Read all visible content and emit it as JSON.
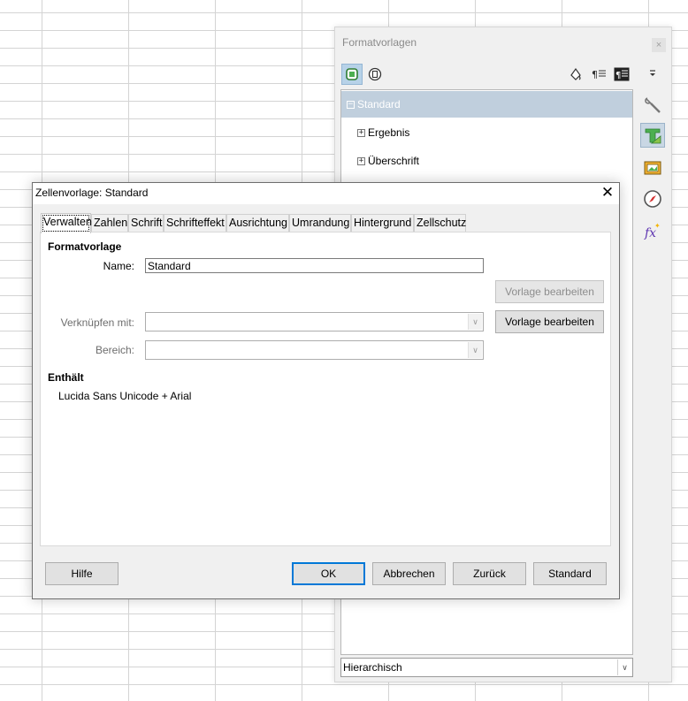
{
  "deck": {
    "title": "Formatvorlagen",
    "close_glyph": "×",
    "toolbar_left": [
      {
        "icon": "cell-styles-icon",
        "active": true
      },
      {
        "icon": "page-styles-icon",
        "active": false
      }
    ],
    "toolbar_right": [
      {
        "icon": "fill-format-mode-icon"
      },
      {
        "icon": "new-style-from-selection-icon"
      },
      {
        "icon": "styles-actions-icon"
      }
    ],
    "tree": {
      "items": [
        {
          "label": "Standard",
          "toggle": "⊟",
          "selected": true
        },
        {
          "label": "Ergebnis",
          "toggle": "⊞",
          "selected": false
        },
        {
          "label": "Überschrift",
          "toggle": "⊞",
          "selected": false
        }
      ]
    },
    "filter": {
      "value": "Hierarchisch",
      "arrow": "∨"
    },
    "sidebar": [
      {
        "icon": "sidebar-menu-icon"
      },
      {
        "icon": "properties-wrench-icon"
      },
      {
        "icon": "styles-icon",
        "active": true
      },
      {
        "icon": "gallery-icon"
      },
      {
        "icon": "navigator-icon"
      },
      {
        "icon": "functions-icon"
      }
    ]
  },
  "dialog": {
    "title": "Zellenvorlage: Standard",
    "close_glyph": "✕",
    "tabs": [
      {
        "label": "Verwalten",
        "active": true
      },
      {
        "label": "Zahlen"
      },
      {
        "label": "Schrift"
      },
      {
        "label": "Schrifteffekt"
      },
      {
        "label": "Ausrichtung"
      },
      {
        "label": "Umrandung"
      },
      {
        "label": "Hintergrund"
      },
      {
        "label": "Zellschutz"
      }
    ],
    "style_section": "Formatvorlage",
    "name": {
      "label": "Name:",
      "value": "Standard"
    },
    "link": {
      "label": "Verknüpfen mit:",
      "value": ""
    },
    "category": {
      "label": "Bereich:",
      "value": ""
    },
    "edit_disabled": "Vorlage bearbeiten",
    "edit": "Vorlage bearbeiten",
    "contains_section": "Enthält",
    "contains_value": "Lucida Sans Unicode + Arial",
    "buttons": {
      "help": "Hilfe",
      "ok": "OK",
      "cancel": "Abbrechen",
      "reset": "Zurück",
      "standard": "Standard"
    }
  },
  "colors": {
    "accent": "#0078d7",
    "tree_selection": "#c0cfdd",
    "active_toolbar": "#b7d2e8"
  }
}
